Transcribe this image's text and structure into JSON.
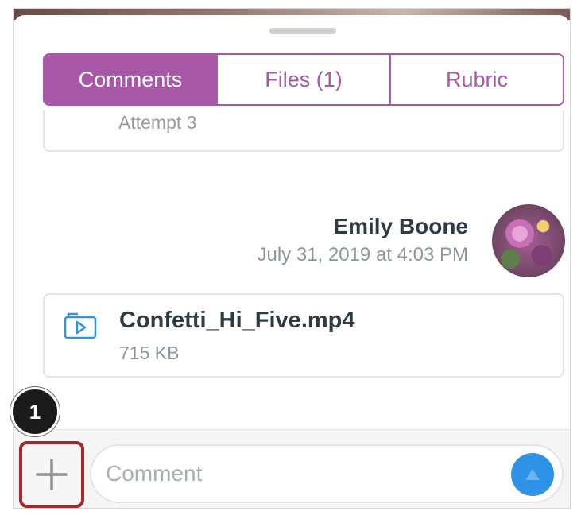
{
  "tabs": [
    {
      "label": "Comments",
      "active": true
    },
    {
      "label": "Files (1)",
      "active": false
    },
    {
      "label": "Rubric",
      "active": false
    }
  ],
  "previous_card": {
    "text": "Attempt 3"
  },
  "comment": {
    "author": "Emily Boone",
    "date": "July 31, 2019 at 4:03 PM",
    "avatar_icon": "user-avatar",
    "attachment": {
      "icon": "video-file-icon",
      "name": "Confetti_Hi_Five.mp4",
      "size": "715 KB"
    }
  },
  "composer": {
    "add_icon": "plus-icon",
    "placeholder": "Comment",
    "send_icon": "send-arrow-icon"
  },
  "annotation": {
    "step": "1"
  },
  "colors": {
    "accent": "#a958a8",
    "send": "#2e93e6",
    "highlight": "#a32a2c",
    "text_dark": "#2d3b45",
    "text_muted": "#8b969e"
  }
}
